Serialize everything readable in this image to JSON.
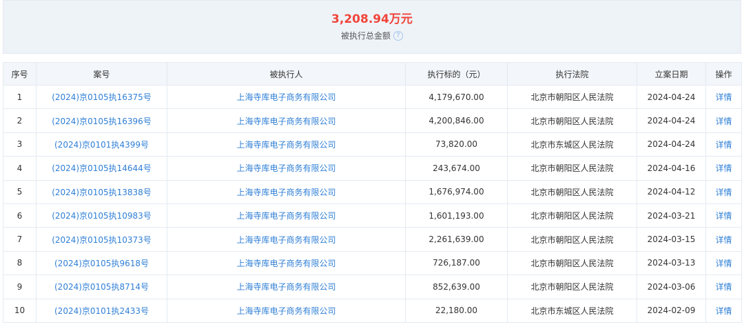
{
  "summary": {
    "total_amount": "3,208.94万元",
    "label": "被执行总金额",
    "help_glyph": "?"
  },
  "table": {
    "headers": [
      "序号",
      "案号",
      "被执行人",
      "执行标的（元）",
      "执行法院",
      "立案日期",
      "操作"
    ],
    "rows": [
      {
        "idx": "1",
        "case_no": "(2024)京0105执16375号",
        "party": "上海寺库电子商务有限公司",
        "amount": "4,179,670.00",
        "court": "北京市朝阳区人民法院",
        "date": "2024-04-24",
        "action": "详情"
      },
      {
        "idx": "2",
        "case_no": "(2024)京0105执16396号",
        "party": "上海寺库电子商务有限公司",
        "amount": "4,200,846.00",
        "court": "北京市朝阳区人民法院",
        "date": "2024-04-24",
        "action": "详情"
      },
      {
        "idx": "3",
        "case_no": "(2024)京0101执4399号",
        "party": "上海寺库电子商务有限公司",
        "amount": "73,820.00",
        "court": "北京市东城区人民法院",
        "date": "2024-04-24",
        "action": "详情"
      },
      {
        "idx": "4",
        "case_no": "(2024)京0105执14644号",
        "party": "上海寺库电子商务有限公司",
        "amount": "243,674.00",
        "court": "北京市朝阳区人民法院",
        "date": "2024-04-16",
        "action": "详情"
      },
      {
        "idx": "5",
        "case_no": "(2024)京0105执13838号",
        "party": "上海寺库电子商务有限公司",
        "amount": "1,676,974.00",
        "court": "北京市朝阳区人民法院",
        "date": "2024-04-12",
        "action": "详情"
      },
      {
        "idx": "6",
        "case_no": "(2024)京0105执10983号",
        "party": "上海寺库电子商务有限公司",
        "amount": "1,601,193.00",
        "court": "北京市朝阳区人民法院",
        "date": "2024-03-21",
        "action": "详情"
      },
      {
        "idx": "7",
        "case_no": "(2024)京0105执10373号",
        "party": "上海寺库电子商务有限公司",
        "amount": "2,261,639.00",
        "court": "北京市朝阳区人民法院",
        "date": "2024-03-15",
        "action": "详情"
      },
      {
        "idx": "8",
        "case_no": "(2024)京0105执9618号",
        "party": "上海寺库电子商务有限公司",
        "amount": "726,187.00",
        "court": "北京市朝阳区人民法院",
        "date": "2024-03-13",
        "action": "详情"
      },
      {
        "idx": "9",
        "case_no": "(2024)京0105执8714号",
        "party": "上海寺库电子商务有限公司",
        "amount": "852,639.00",
        "court": "北京市朝阳区人民法院",
        "date": "2024-03-06",
        "action": "详情"
      },
      {
        "idx": "10",
        "case_no": "(2024)京0101执2433号",
        "party": "上海寺库电子商务有限公司",
        "amount": "22,180.00",
        "court": "北京市东城区人民法院",
        "date": "2024-02-09",
        "action": "详情"
      }
    ]
  }
}
